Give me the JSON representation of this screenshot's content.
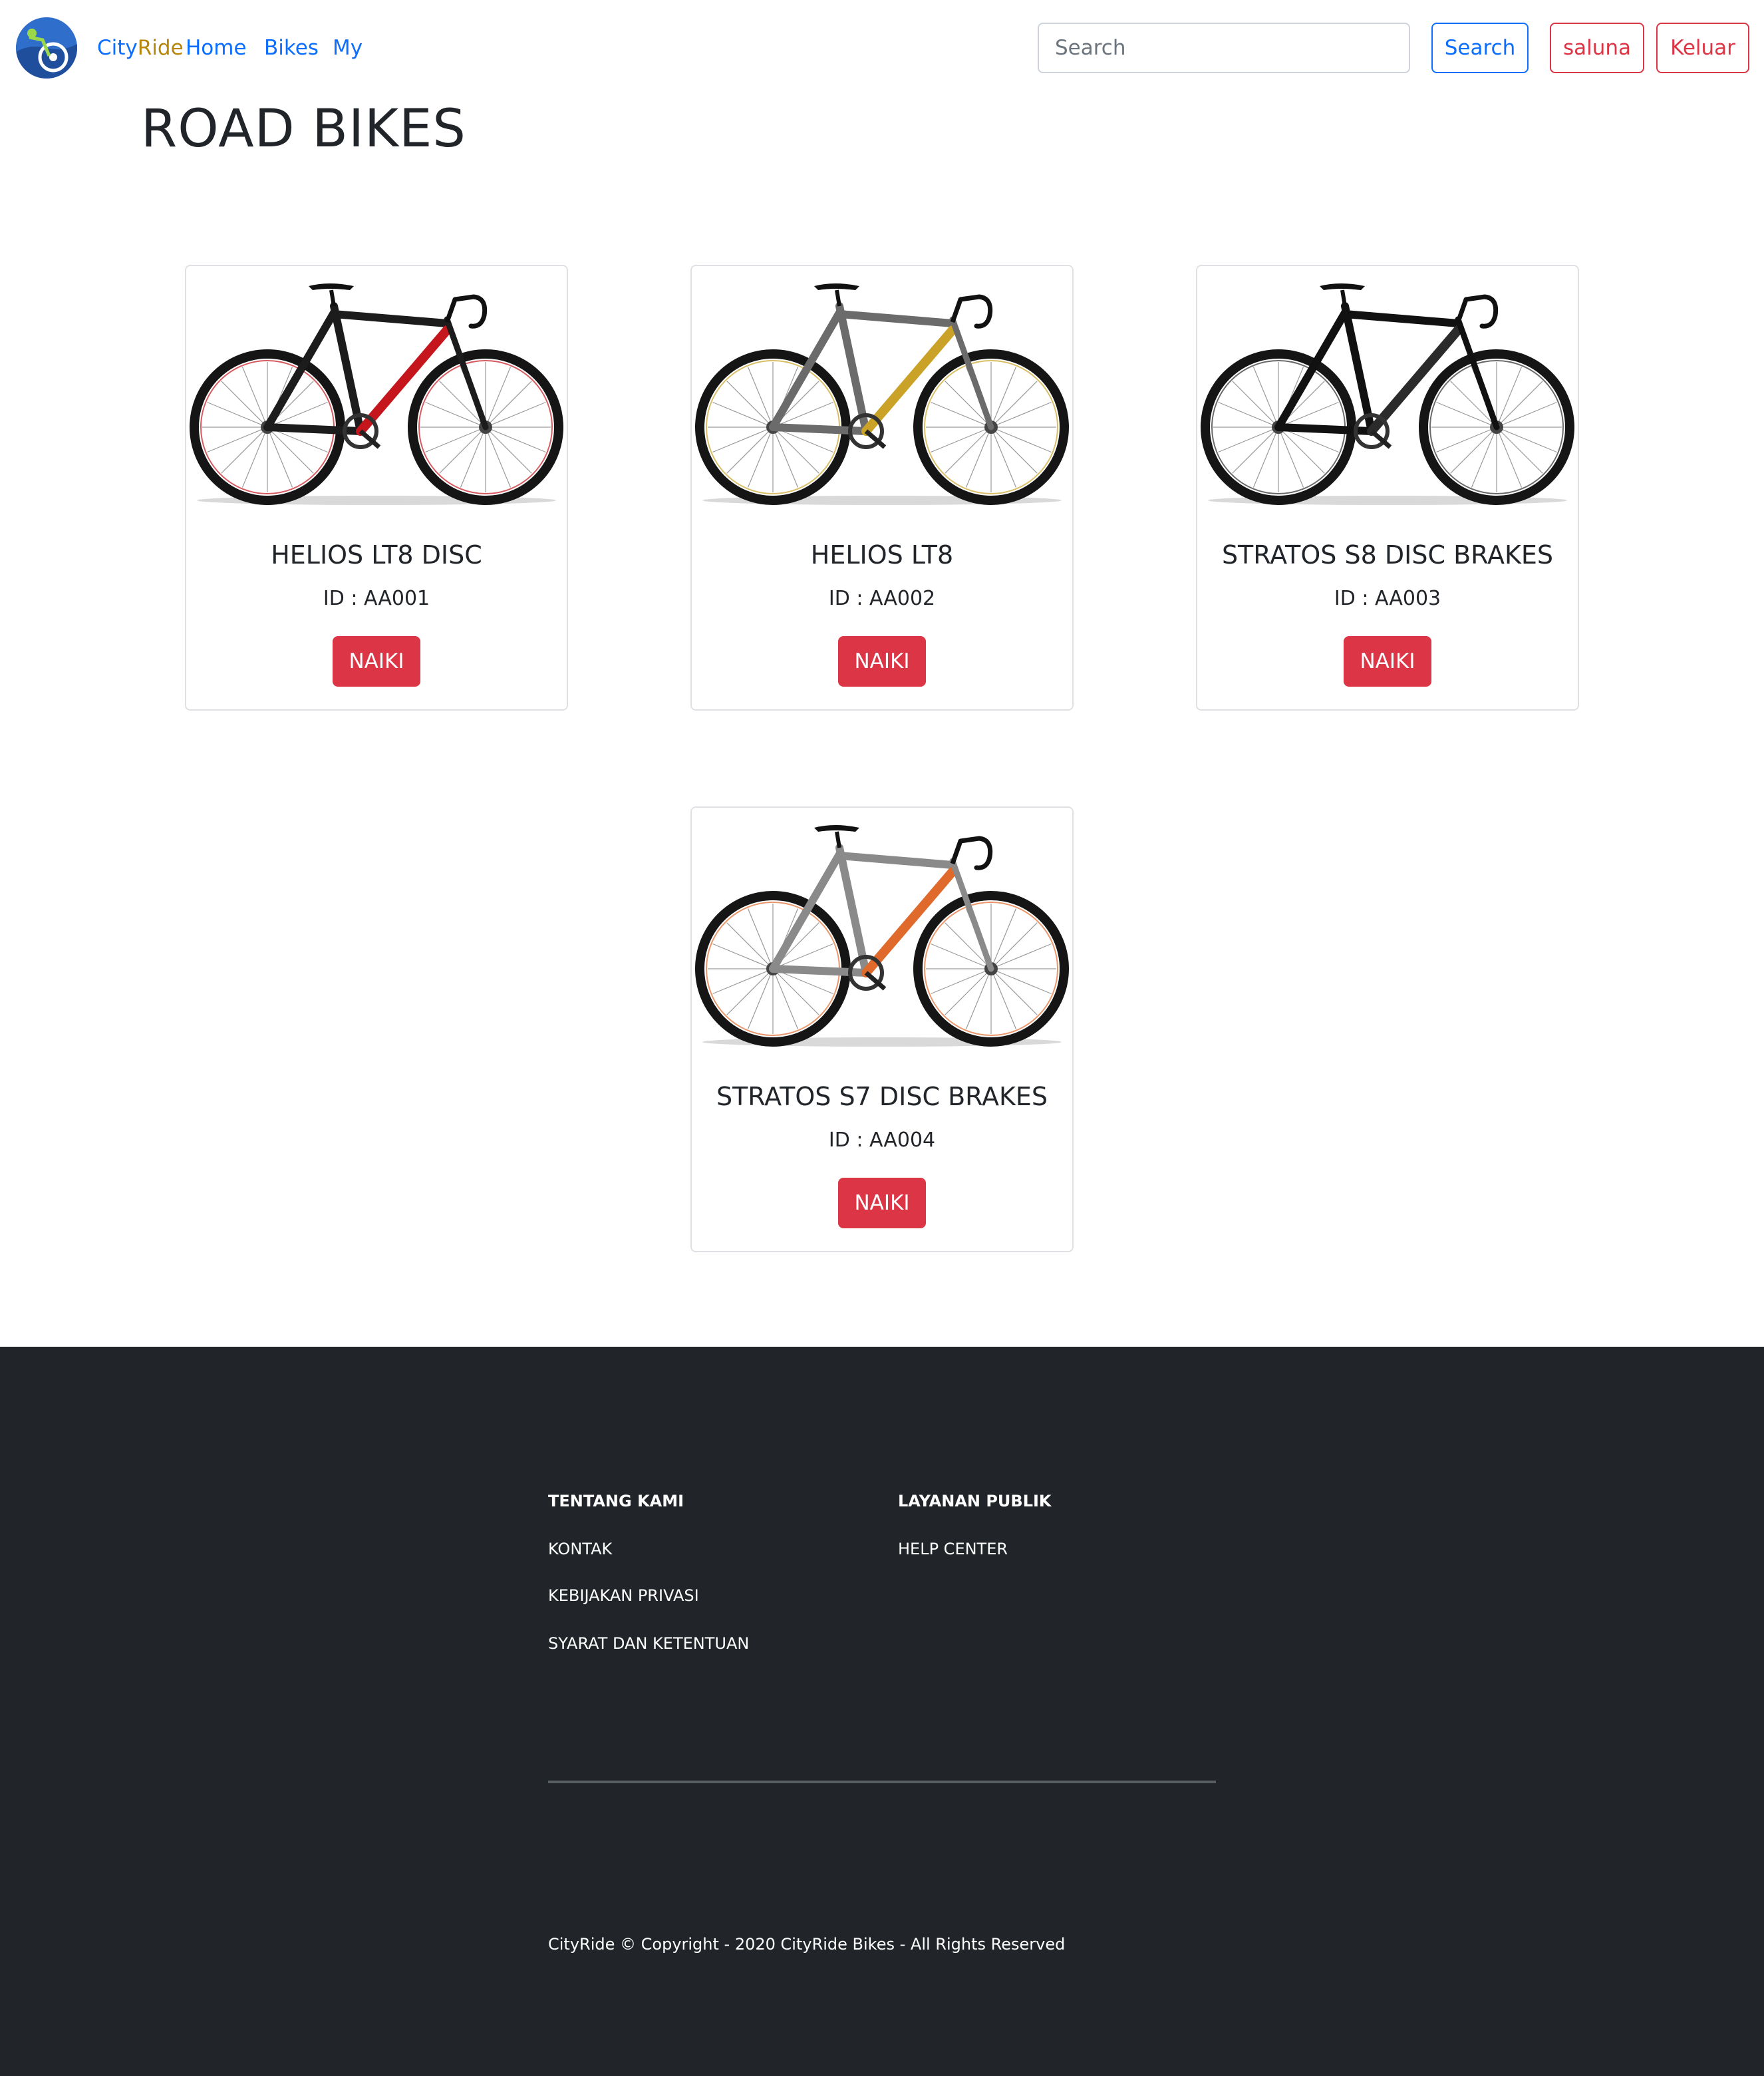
{
  "navbar": {
    "brand_city": "City",
    "brand_ride": "Ride",
    "links": [
      "Home",
      "Bikes",
      "My"
    ],
    "search_placeholder": "Search",
    "search_button": "Search",
    "user_button": "saluna",
    "logout_button": "Keluar"
  },
  "page": {
    "title": "ROAD BIKES"
  },
  "bikes": [
    {
      "name": "HELIOS LT8 DISC",
      "id_label": "ID : AA001",
      "button": "NAIKI",
      "frame_color": "#1c1c1c",
      "accent_color": "#c4161c"
    },
    {
      "name": "HELIOS LT8",
      "id_label": "ID : AA002",
      "button": "NAIKI",
      "frame_color": "#6b6b6b",
      "accent_color": "#c9a227"
    },
    {
      "name": "STRATOS S8 DISC BRAKES",
      "id_label": "ID : AA003",
      "button": "NAIKI",
      "frame_color": "#111111",
      "accent_color": "#2b2b2b"
    },
    {
      "name": "STRATOS S7 DISC BRAKES",
      "id_label": "ID : AA004",
      "button": "NAIKI",
      "frame_color": "#8a8a8a",
      "accent_color": "#e06a2b"
    }
  ],
  "footer": {
    "col1_heading": "TENTANG KAMI",
    "col1_links": [
      "KONTAK",
      "KEBIJAKAN PRIVASI",
      "SYARAT DAN KETENTUAN"
    ],
    "col2_heading": "LAYANAN PUBLIK",
    "col2_links": [
      "HELP CENTER"
    ],
    "copyright": "CityRide © Copyright - 2020 CityRide Bikes - All Rights Reserved"
  },
  "colors": {
    "primary": "#0d6efd",
    "danger": "#dc3545",
    "footer_bg": "#212529",
    "brand_ride": "#b8860b"
  }
}
